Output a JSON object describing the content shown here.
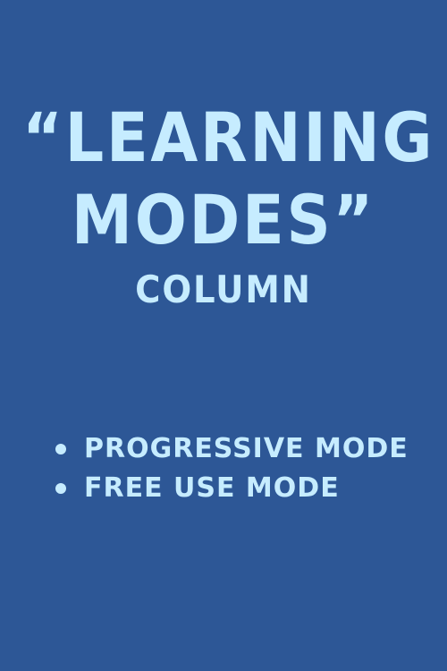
{
  "background_color": "#2d5796",
  "text_color": "#c6ecff",
  "title": {
    "line1": "“Learning",
    "line2": "Modes”",
    "subtitle": "Column"
  },
  "list": {
    "items": [
      {
        "label": "Progressive Mode"
      },
      {
        "label": "Free Use Mode"
      }
    ]
  }
}
